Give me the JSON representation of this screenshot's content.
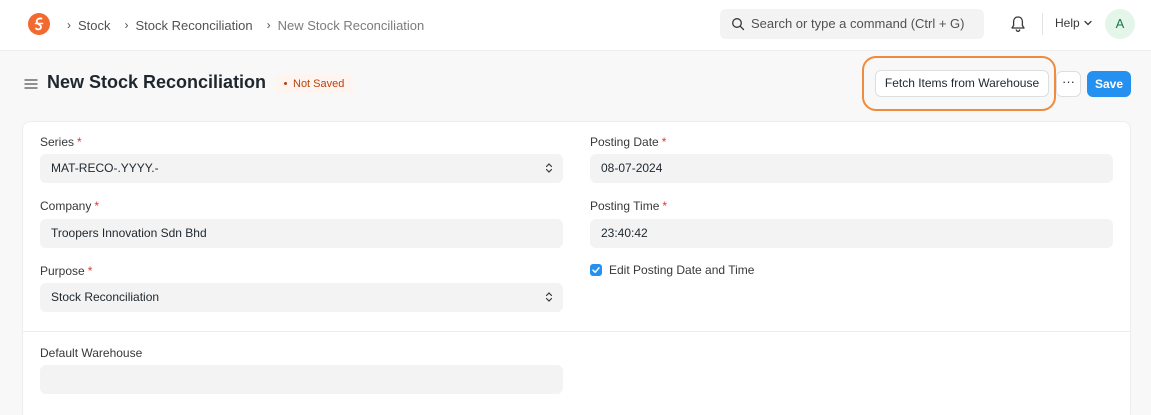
{
  "breadcrumbs": [
    "Stock",
    "Stock Reconciliation",
    "New Stock Reconciliation"
  ],
  "search": {
    "placeholder": "Search or type a command (Ctrl + G)"
  },
  "nav": {
    "help_label": "Help",
    "avatar_initial": "A"
  },
  "page": {
    "title": "New Stock Reconciliation",
    "status": "Not Saved",
    "fetch_button": "Fetch Items from Warehouse",
    "more_button": "···",
    "save_button": "Save"
  },
  "form": {
    "series": {
      "label": "Series",
      "value": "MAT-RECO-.YYYY.-"
    },
    "company": {
      "label": "Company",
      "value": "Troopers Innovation Sdn Bhd"
    },
    "purpose": {
      "label": "Purpose",
      "value": "Stock Reconciliation"
    },
    "posting_date": {
      "label": "Posting Date",
      "value": "08-07-2024"
    },
    "posting_time": {
      "label": "Posting Time",
      "value": "23:40:42"
    },
    "edit_posting": {
      "label": "Edit Posting Date and Time",
      "checked": true
    },
    "default_warehouse": {
      "label": "Default Warehouse",
      "value": ""
    }
  },
  "colors": {
    "accent": "#2490ef",
    "logo": "#f26a30",
    "highlight": "#f08a3c",
    "status": "#bd3e0c"
  }
}
